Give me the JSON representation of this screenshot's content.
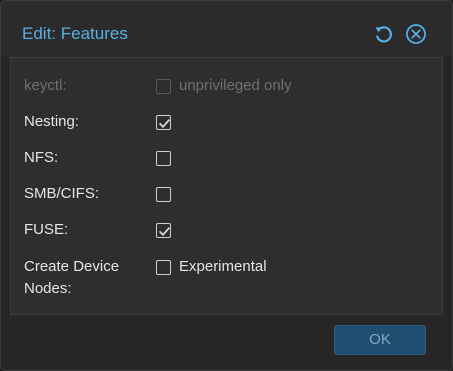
{
  "dialog": {
    "title": "Edit: Features",
    "tools": [
      {
        "icon": "reset-icon"
      },
      {
        "icon": "close-icon"
      }
    ]
  },
  "fields": [
    {
      "label": "keyctl:",
      "checked": false,
      "disabled": true,
      "box_label": "unprivileged only"
    },
    {
      "label": "Nesting:",
      "checked": true,
      "disabled": false,
      "box_label": ""
    },
    {
      "label": "NFS:",
      "checked": false,
      "disabled": false,
      "box_label": ""
    },
    {
      "label": "SMB/CIFS:",
      "checked": false,
      "disabled": false,
      "box_label": ""
    },
    {
      "label": "FUSE:",
      "checked": true,
      "disabled": false,
      "box_label": ""
    },
    {
      "label_line1": "Create Device",
      "label_line2": "Nodes:",
      "checked": false,
      "disabled": false,
      "box_label": "Experimental"
    }
  ],
  "footer": {
    "ok_label": "OK"
  },
  "colors": {
    "accent": "#5aaee8",
    "ok_button": "#1f4e70"
  }
}
